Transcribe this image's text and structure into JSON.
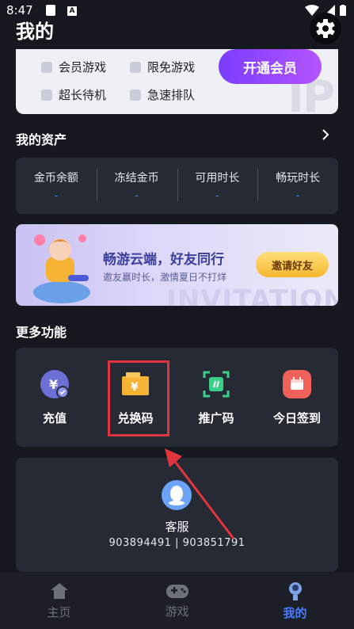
{
  "status_bar": {
    "time": "8:47",
    "a_badge": "A"
  },
  "header": {
    "title": "我的"
  },
  "vip": {
    "features": [
      "会员游戏",
      "限免游戏",
      "超长待机",
      "急速排队"
    ],
    "open_button": "开通会员",
    "watermark": "IP"
  },
  "assets": {
    "title": "我的资产",
    "items": [
      {
        "label": "金币余额",
        "value": "-"
      },
      {
        "label": "冻结金币",
        "value": "-"
      },
      {
        "label": "可用时长",
        "value": "-"
      },
      {
        "label": "畅玩时长",
        "value": "-"
      }
    ]
  },
  "banner": {
    "title": "畅游云端，好友同行",
    "subtitle": "邀友赢时长，激情夏日不打烊",
    "button": "邀请好友",
    "watermark": "INVITATION"
  },
  "more": {
    "title": "更多功能",
    "items": [
      {
        "label": "充值",
        "icon": "recharge-icon",
        "color": "#6b6fd6"
      },
      {
        "label": "兑换码",
        "icon": "ticket-icon",
        "color": "#f5b233"
      },
      {
        "label": "推广码",
        "icon": "scan-icon",
        "color": "#3ad08a"
      },
      {
        "label": "今日签到",
        "icon": "calendar-icon",
        "color": "#f0615c"
      }
    ]
  },
  "support": {
    "label": "客服",
    "numbers": "903894491 | 903851791"
  },
  "nav": {
    "items": [
      {
        "label": "主页",
        "active": false
      },
      {
        "label": "游戏",
        "active": false
      },
      {
        "label": "我的",
        "active": true
      }
    ]
  },
  "colors": {
    "accent": "#4a7dff",
    "highlight": "#e0343e",
    "vip_purple": "#7b3cff"
  }
}
